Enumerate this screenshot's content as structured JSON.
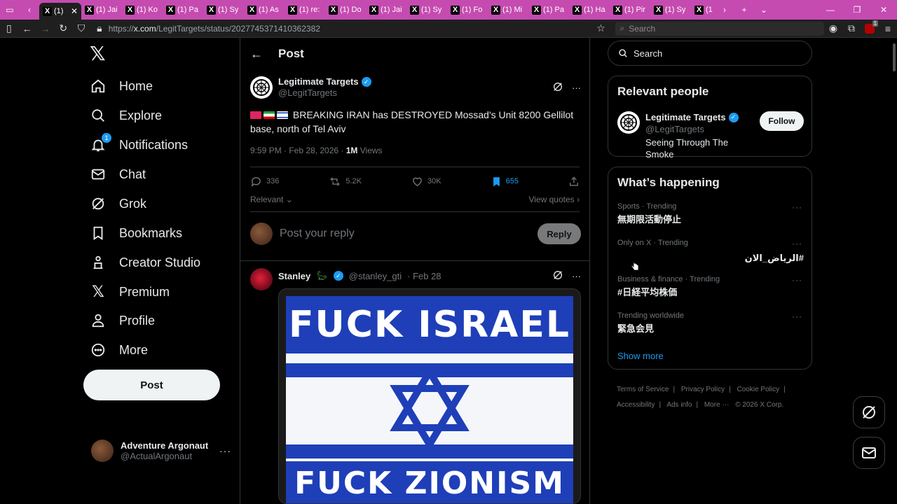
{
  "browser": {
    "tabs": [
      {
        "label": "(1)",
        "active": true
      },
      {
        "label": "(1) Jai"
      },
      {
        "label": "(1) Ko"
      },
      {
        "label": "(1) Pa"
      },
      {
        "label": "(1) Sy"
      },
      {
        "label": "(1) As"
      },
      {
        "label": "(1) re:"
      },
      {
        "label": "(1) Do"
      },
      {
        "label": "(1) Jai"
      },
      {
        "label": "(1) Sy"
      },
      {
        "label": "(1) Fo"
      },
      {
        "label": "(1) Mi"
      },
      {
        "label": "(1) Pa"
      },
      {
        "label": "(1) Ha"
      },
      {
        "label": "(1) Pir"
      },
      {
        "label": "(1) Sy"
      },
      {
        "label": "(1"
      }
    ],
    "url_prefix": "https://",
    "url_host": "x.com",
    "url_path": "/LegitTargets/status/2027745371410362382",
    "search_placeholder": "Search",
    "ext_badge": "1"
  },
  "nav": {
    "items": [
      {
        "label": "Home",
        "icon": "home-icon"
      },
      {
        "label": "Explore",
        "icon": "search-icon"
      },
      {
        "label": "Notifications",
        "icon": "bell-icon",
        "badge": "1"
      },
      {
        "label": "Chat",
        "icon": "mail-icon"
      },
      {
        "label": "Grok",
        "icon": "grok-icon"
      },
      {
        "label": "Bookmarks",
        "icon": "bookmark-icon"
      },
      {
        "label": "Creator Studio",
        "icon": "creator-icon"
      },
      {
        "label": "Premium",
        "icon": "x-icon"
      },
      {
        "label": "Profile",
        "icon": "person-icon"
      },
      {
        "label": "More",
        "icon": "more-circle-icon"
      }
    ],
    "post_label": "Post",
    "account": {
      "name": "Adventure Argonaut",
      "handle": "@ActualArgonaut"
    }
  },
  "post": {
    "header_title": "Post",
    "author_name": "Legitimate Targets",
    "author_handle": "@LegitTargets",
    "text": "BREAKING IRAN has DESTROYED Mossad's Unit 8200 Gellilot base, north of Tel Aviv",
    "time": "9:59 PM · Feb 28, 2026 · ",
    "views_count": "1M",
    "views_label": " Views",
    "replies": "336",
    "reposts": "5.2K",
    "likes": "30K",
    "bookmarks": "655",
    "sort_label": "Relevant",
    "view_quotes": "View quotes",
    "reply_placeholder": "Post your reply",
    "reply_button": "Reply"
  },
  "reply": {
    "name": "Stanley",
    "handle": "@stanley_gti",
    "date": "· Feb 28",
    "image_top": "FUCK ISRAEL",
    "image_bottom": "FUCK ZIONISM"
  },
  "right": {
    "search_placeholder": "Search",
    "relevant_title": "Relevant people",
    "person": {
      "name": "Legitimate Targets",
      "handle": "@LegitTargets",
      "bio": "Seeing Through The Smoke",
      "follow": "Follow"
    },
    "happening_title": "What’s happening",
    "trends": [
      {
        "meta": "Sports · Trending",
        "name": "無期限活動停止"
      },
      {
        "meta": "Only on X · Trending",
        "name": "#الرياض_الان"
      },
      {
        "meta": "Business & finance · Trending",
        "name": "#日経平均株価"
      },
      {
        "meta": "Trending worldwide",
        "name": "緊急会見"
      }
    ],
    "show_more": "Show more",
    "footer": {
      "terms": "Terms of Service",
      "privacy": "Privacy Policy",
      "cookie": "Cookie Policy",
      "accessibility": "Accessibility",
      "ads": "Ads info",
      "more": "More ···",
      "copyright": "© 2026 X Corp."
    }
  },
  "colors": {
    "accent": "#1d9bf0",
    "tabbar": "#c54bb0",
    "background": "#000000"
  }
}
